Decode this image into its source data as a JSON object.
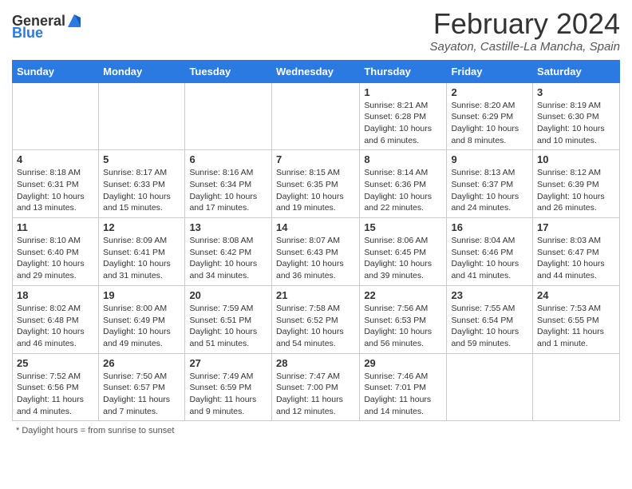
{
  "header": {
    "logo_general": "General",
    "logo_blue": "Blue",
    "title": "February 2024",
    "subtitle": "Sayaton, Castille-La Mancha, Spain"
  },
  "calendar": {
    "days_of_week": [
      "Sunday",
      "Monday",
      "Tuesday",
      "Wednesday",
      "Thursday",
      "Friday",
      "Saturday"
    ],
    "weeks": [
      [
        {
          "day": "",
          "info": ""
        },
        {
          "day": "",
          "info": ""
        },
        {
          "day": "",
          "info": ""
        },
        {
          "day": "",
          "info": ""
        },
        {
          "day": "1",
          "info": "Sunrise: 8:21 AM\nSunset: 6:28 PM\nDaylight: 10 hours\nand 6 minutes."
        },
        {
          "day": "2",
          "info": "Sunrise: 8:20 AM\nSunset: 6:29 PM\nDaylight: 10 hours\nand 8 minutes."
        },
        {
          "day": "3",
          "info": "Sunrise: 8:19 AM\nSunset: 6:30 PM\nDaylight: 10 hours\nand 10 minutes."
        }
      ],
      [
        {
          "day": "4",
          "info": "Sunrise: 8:18 AM\nSunset: 6:31 PM\nDaylight: 10 hours\nand 13 minutes."
        },
        {
          "day": "5",
          "info": "Sunrise: 8:17 AM\nSunset: 6:33 PM\nDaylight: 10 hours\nand 15 minutes."
        },
        {
          "day": "6",
          "info": "Sunrise: 8:16 AM\nSunset: 6:34 PM\nDaylight: 10 hours\nand 17 minutes."
        },
        {
          "day": "7",
          "info": "Sunrise: 8:15 AM\nSunset: 6:35 PM\nDaylight: 10 hours\nand 19 minutes."
        },
        {
          "day": "8",
          "info": "Sunrise: 8:14 AM\nSunset: 6:36 PM\nDaylight: 10 hours\nand 22 minutes."
        },
        {
          "day": "9",
          "info": "Sunrise: 8:13 AM\nSunset: 6:37 PM\nDaylight: 10 hours\nand 24 minutes."
        },
        {
          "day": "10",
          "info": "Sunrise: 8:12 AM\nSunset: 6:39 PM\nDaylight: 10 hours\nand 26 minutes."
        }
      ],
      [
        {
          "day": "11",
          "info": "Sunrise: 8:10 AM\nSunset: 6:40 PM\nDaylight: 10 hours\nand 29 minutes."
        },
        {
          "day": "12",
          "info": "Sunrise: 8:09 AM\nSunset: 6:41 PM\nDaylight: 10 hours\nand 31 minutes."
        },
        {
          "day": "13",
          "info": "Sunrise: 8:08 AM\nSunset: 6:42 PM\nDaylight: 10 hours\nand 34 minutes."
        },
        {
          "day": "14",
          "info": "Sunrise: 8:07 AM\nSunset: 6:43 PM\nDaylight: 10 hours\nand 36 minutes."
        },
        {
          "day": "15",
          "info": "Sunrise: 8:06 AM\nSunset: 6:45 PM\nDaylight: 10 hours\nand 39 minutes."
        },
        {
          "day": "16",
          "info": "Sunrise: 8:04 AM\nSunset: 6:46 PM\nDaylight: 10 hours\nand 41 minutes."
        },
        {
          "day": "17",
          "info": "Sunrise: 8:03 AM\nSunset: 6:47 PM\nDaylight: 10 hours\nand 44 minutes."
        }
      ],
      [
        {
          "day": "18",
          "info": "Sunrise: 8:02 AM\nSunset: 6:48 PM\nDaylight: 10 hours\nand 46 minutes."
        },
        {
          "day": "19",
          "info": "Sunrise: 8:00 AM\nSunset: 6:49 PM\nDaylight: 10 hours\nand 49 minutes."
        },
        {
          "day": "20",
          "info": "Sunrise: 7:59 AM\nSunset: 6:51 PM\nDaylight: 10 hours\nand 51 minutes."
        },
        {
          "day": "21",
          "info": "Sunrise: 7:58 AM\nSunset: 6:52 PM\nDaylight: 10 hours\nand 54 minutes."
        },
        {
          "day": "22",
          "info": "Sunrise: 7:56 AM\nSunset: 6:53 PM\nDaylight: 10 hours\nand 56 minutes."
        },
        {
          "day": "23",
          "info": "Sunrise: 7:55 AM\nSunset: 6:54 PM\nDaylight: 10 hours\nand 59 minutes."
        },
        {
          "day": "24",
          "info": "Sunrise: 7:53 AM\nSunset: 6:55 PM\nDaylight: 11 hours\nand 1 minute."
        }
      ],
      [
        {
          "day": "25",
          "info": "Sunrise: 7:52 AM\nSunset: 6:56 PM\nDaylight: 11 hours\nand 4 minutes."
        },
        {
          "day": "26",
          "info": "Sunrise: 7:50 AM\nSunset: 6:57 PM\nDaylight: 11 hours\nand 7 minutes."
        },
        {
          "day": "27",
          "info": "Sunrise: 7:49 AM\nSunset: 6:59 PM\nDaylight: 11 hours\nand 9 minutes."
        },
        {
          "day": "28",
          "info": "Sunrise: 7:47 AM\nSunset: 7:00 PM\nDaylight: 11 hours\nand 12 minutes."
        },
        {
          "day": "29",
          "info": "Sunrise: 7:46 AM\nSunset: 7:01 PM\nDaylight: 11 hours\nand 14 minutes."
        },
        {
          "day": "",
          "info": ""
        },
        {
          "day": "",
          "info": ""
        }
      ]
    ],
    "footer_note": "Daylight hours"
  }
}
